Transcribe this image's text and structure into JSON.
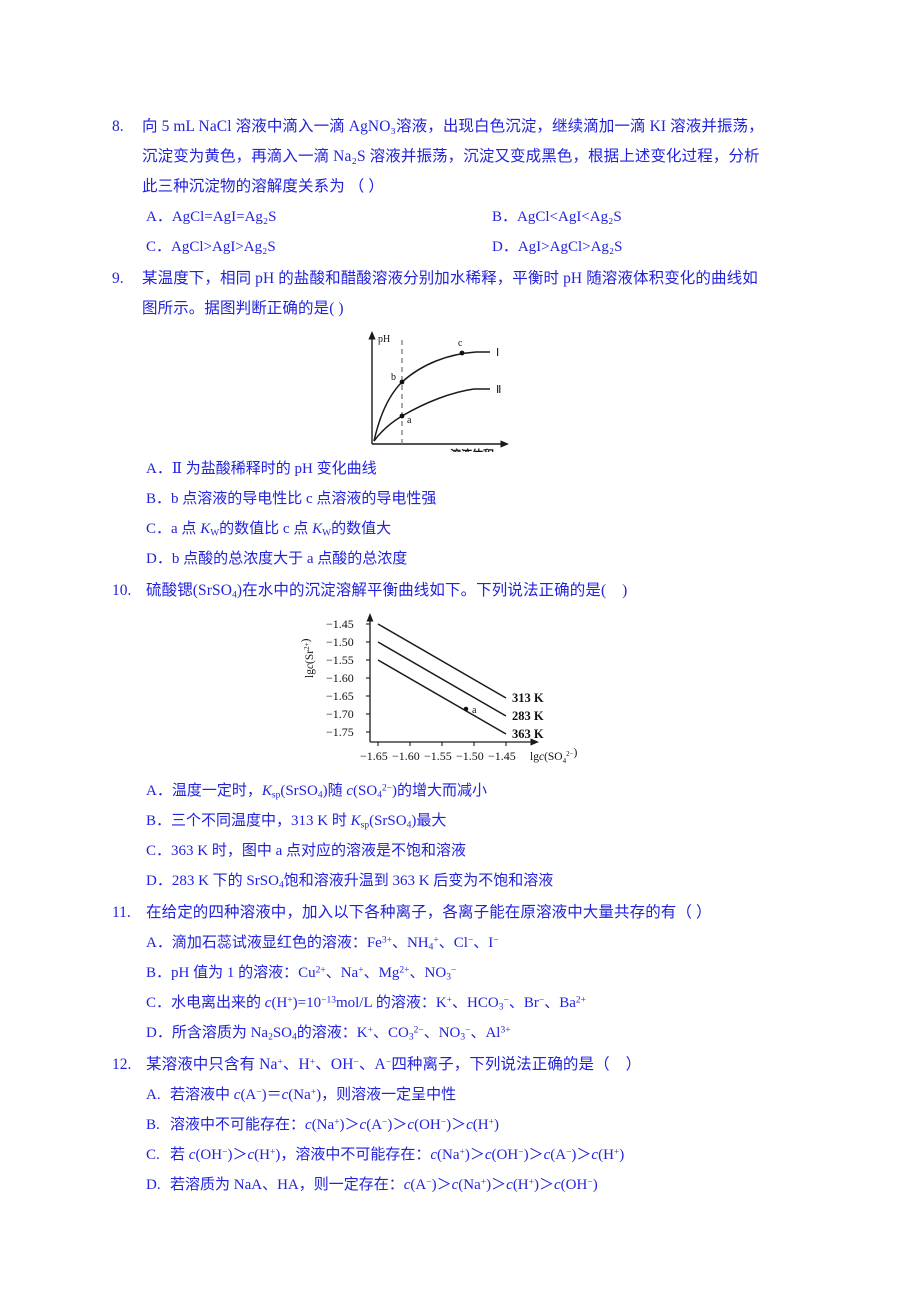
{
  "page": {
    "text_color": "#2222dd",
    "background": "#ffffff"
  },
  "questions": [
    {
      "number": "8.",
      "stem_lines": [
        "向 5 mL NaCl 溶液中滴入一滴 AgNO₃溶液，出现白色沉淀，继续滴加一滴 KI 溶液并振荡，",
        "沉淀变为黄色，再滴入一滴 Na₂S 溶液并振荡，沉淀又变成黑色，根据上述变化过程，分析",
        "此三种沉淀物的溶解度关系为  （   ）"
      ],
      "options": [
        {
          "label": "A．",
          "text": "AgCl=AgI=Ag₂S"
        },
        {
          "label": "B．",
          "text": "AgCl<AgI<Ag₂S"
        },
        {
          "label": "C．",
          "text": "AgCl>AgI>Ag₂S"
        },
        {
          "label": "D．",
          "text": "AgI>AgCl>Ag₂S"
        }
      ]
    },
    {
      "number": "9.",
      "stem_lines": [
        "某温度下，相同 pH 的盐酸和醋酸溶液分别加水稀释，平衡时 pH 随溶液体积变化的曲线如",
        "图所示。据图判断正确的是(    )"
      ],
      "options": [
        {
          "label": "A．",
          "text": "Ⅱ 为盐酸稀释时的 pH 变化曲线"
        },
        {
          "label": "B．",
          "text": "b 点溶液的导电性比 c 点溶液的导电性强"
        },
        {
          "label": "C．",
          "text": "a 点 K_W 的数值比 c 点 K_W 的数值大"
        },
        {
          "label": "D．",
          "text": "b 点酸的总浓度大于 a 点酸的总浓度"
        }
      ]
    },
    {
      "number": "10.",
      "stem_lines": [
        "硫酸锶(SrSO₄)在水中的沉淀溶解平衡曲线如下。下列说法正确的是(    )"
      ],
      "options": [
        {
          "label": "A．",
          "text": "温度一定时，K_sp(SrSO₄)随 c(SO₄²⁻)的增大而减小"
        },
        {
          "label": "B．",
          "text": "三个不同温度中，313 K 时 K_sp(SrSO₄)最大"
        },
        {
          "label": "C．",
          "text": "363 K 时，图中 a 点对应的溶液是不饱和溶液"
        },
        {
          "label": "D．",
          "text": "283 K 下的 SrSO₄饱和溶液升温到 363 K 后变为不饱和溶液"
        }
      ]
    },
    {
      "number": "11.",
      "stem_lines": [
        "在给定的四种溶液中，加入以下各种离子，各离子能在原溶液中大量共存的有（    ）"
      ],
      "options": [
        {
          "label": "A．",
          "text": "滴加石蕊试液显红色的溶液：Fe³⁺、NH₄⁺、Cl⁻、I⁻"
        },
        {
          "label": "B．",
          "text": "pH 值为 1 的溶液：Cu²⁺、Na⁺、Mg²⁺、NO₃⁻"
        },
        {
          "label": "C．",
          "text": "水电离出来的 c(H⁺)=10⁻¹³mol/L 的溶液：K⁺、HCO₃⁻、Br⁻、Ba²⁺"
        },
        {
          "label": "D．",
          "text": "所含溶质为 Na₂SO₄的溶液：K⁺、CO₃²⁻、NO₃⁻、Al³⁺"
        }
      ]
    },
    {
      "number": "12.",
      "stem_lines": [
        "某溶液中只含有 Na⁺、H⁺、OH⁻、A⁻四种离子，下列说法正确的是（    ）"
      ],
      "options": [
        {
          "label": "A.",
          "text": "若溶液中 c(A⁻)＝c(Na⁺)，则溶液一定呈中性"
        },
        {
          "label": "B.",
          "text": "溶液中不可能存在：c(Na⁺)＞c(A⁻)＞c(OH⁻)＞c(H⁺)"
        },
        {
          "label": "C.",
          "text": "若 c(OH⁻)＞c(H⁺)，溶液中不可能存在：c(Na⁺)＞c(OH⁻)＞c(A⁻)＞c(H⁺)"
        },
        {
          "label": "D.",
          "text": "若溶质为 NaA、HA，则一定存在：c(A⁻)＞c(Na⁺)＞c(H⁺)＞c(OH⁻)"
        }
      ]
    }
  ],
  "chart_data": [
    {
      "id": "ph-dilution-curve",
      "type": "line",
      "title": "",
      "xlabel": "溶液体积",
      "ylabel": "pH",
      "grid": false,
      "axis_ticks": false,
      "series": [
        {
          "name": "Ⅰ",
          "label": "Ⅰ",
          "description": "醋酸稀释曲线（上方曲线）"
        },
        {
          "name": "Ⅱ",
          "label": "Ⅱ",
          "description": "盐酸稀释曲线（下方曲线）"
        }
      ],
      "annotations": [
        {
          "label": "b",
          "series": "Ⅰ",
          "note": "位于虚线与曲线Ⅰ交点"
        },
        {
          "label": "c",
          "series": "Ⅰ",
          "note": "曲线Ⅰ右侧点"
        },
        {
          "label": "a",
          "series": "Ⅱ",
          "note": "位于虚线与曲线Ⅱ交点"
        }
      ],
      "dashed_line": "垂直虚线"
    },
    {
      "id": "srso4-precipitation-equilibrium",
      "type": "line",
      "title": "",
      "xlabel": "lgc(SO₄²⁻)",
      "ylabel": "lgc(Sr²⁺)",
      "grid": false,
      "xticks": [
        "-1.65",
        "-1.60",
        "-1.55",
        "-1.50",
        "-1.45"
      ],
      "yticks": [
        "-1.45",
        "-1.50",
        "-1.55",
        "-1.60",
        "-1.65",
        "-1.70",
        "-1.75"
      ],
      "xlim": [
        -1.675,
        -1.43
      ],
      "ylim": [
        -1.78,
        -1.43
      ],
      "series": [
        {
          "name": "313 K",
          "label": "313 K",
          "x": [
            -1.65,
            -1.45
          ],
          "y": [
            -1.45,
            -1.655
          ]
        },
        {
          "name": "283 K",
          "label": "283 K",
          "x": [
            -1.65,
            -1.45
          ],
          "y": [
            -1.5,
            -1.705
          ]
        },
        {
          "name": "363 K",
          "label": "363 K",
          "x": [
            -1.65,
            -1.45
          ],
          "y": [
            -1.55,
            -1.755
          ]
        }
      ],
      "annotations": [
        {
          "label": "a",
          "x": -1.505,
          "y": -1.683
        }
      ],
      "legend_position": "right-of-line-ends"
    }
  ]
}
